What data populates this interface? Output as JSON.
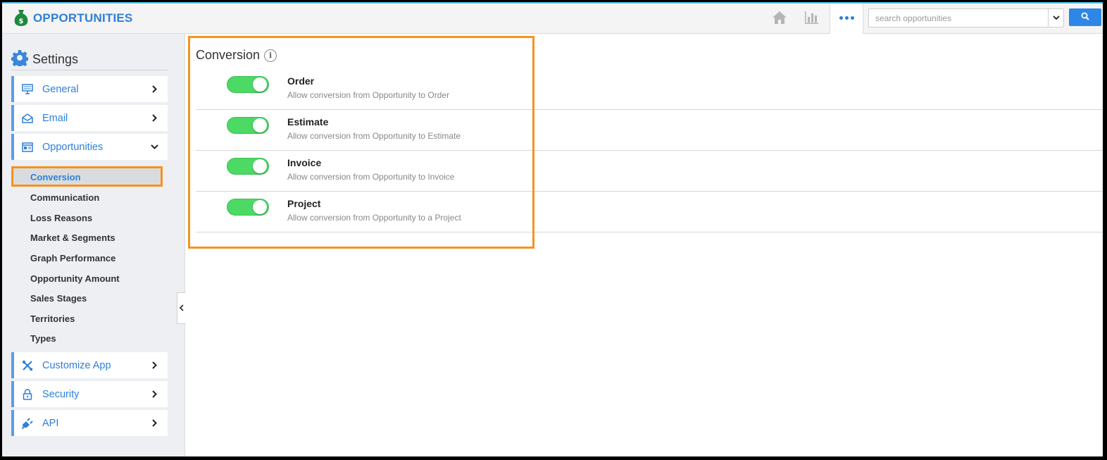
{
  "header": {
    "app_title": "OPPORTUNITIES",
    "search_placeholder": "search opportunities",
    "icons": [
      "money-bag-icon",
      "home-icon",
      "bar-chart-icon",
      "more-dots-icon",
      "chevron-down-icon",
      "search-icon"
    ],
    "accent_color": "#2e7fd9"
  },
  "sidebar": {
    "title": "Settings",
    "items": [
      {
        "label": "General",
        "icon": "monitor-icon"
      },
      {
        "label": "Email",
        "icon": "envelope-icon"
      },
      {
        "label": "Opportunities",
        "icon": "window-icon",
        "expanded": true
      },
      {
        "label": "Customize App",
        "icon": "tools-icon"
      },
      {
        "label": "Security",
        "icon": "lock-icon"
      },
      {
        "label": "API",
        "icon": "plug-icon"
      }
    ],
    "subitems": [
      {
        "label": "Conversion",
        "active": true
      },
      {
        "label": "Communication"
      },
      {
        "label": "Loss Reasons"
      },
      {
        "label": "Market & Segments"
      },
      {
        "label": "Graph Performance"
      },
      {
        "label": "Opportunity Amount"
      },
      {
        "label": "Sales Stages"
      },
      {
        "label": "Territories"
      },
      {
        "label": "Types"
      }
    ]
  },
  "main": {
    "section_title": "Conversion",
    "options": [
      {
        "name": "Order",
        "desc": "Allow conversion from Opportunity to Order",
        "enabled": true
      },
      {
        "name": "Estimate",
        "desc": "Allow conversion from Opportunity to Estimate",
        "enabled": true
      },
      {
        "name": "Invoice",
        "desc": "Allow conversion from Opportunity to Invoice",
        "enabled": true
      },
      {
        "name": "Project",
        "desc": "Allow conversion from Opportunity to a Project",
        "enabled": true
      }
    ],
    "toggle_color": "#4cd964",
    "highlight_color": "#f7931e"
  }
}
